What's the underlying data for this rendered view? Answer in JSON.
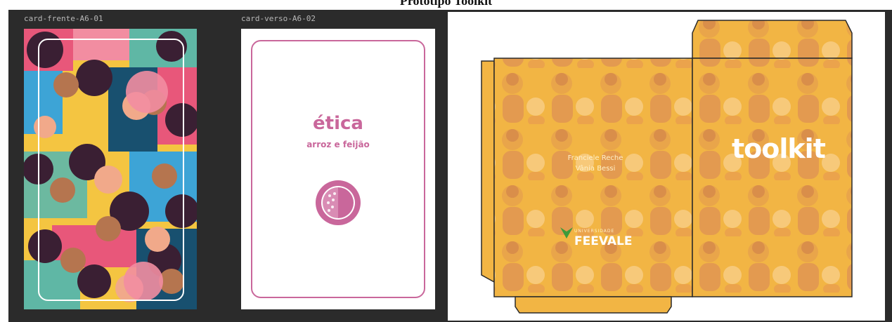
{
  "page": {
    "title": "Protótipo Toolkit"
  },
  "artboards": [
    {
      "label": "card-frente-A6-01"
    },
    {
      "label": "card-verso-A6-02"
    }
  ],
  "card_back": {
    "title": "ética",
    "subtitle": "arroz e feijão",
    "badge_icon": "rice-beans-plate-icon"
  },
  "envelope": {
    "authors": [
      "Franciele Reche",
      "Vânia Bessi"
    ],
    "cover_word": "toolkit",
    "logo": {
      "top_text": "UNIVERSIDADE",
      "name": "FEEVALE"
    }
  },
  "colors": {
    "pane_background": "#2b2b2b",
    "accent_pink": "#c9679b",
    "envelope_yellow": "#f2b544",
    "dieline_stroke": "#2a2a2a"
  }
}
